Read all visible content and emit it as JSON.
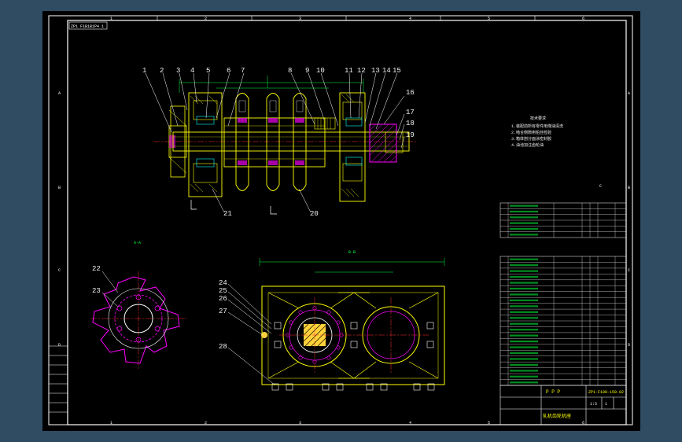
{
  "app": {
    "colors": {
      "desktop": "#2f4c63",
      "sheet": "#000000",
      "border": "#ffffff",
      "yellow": "#ffff00",
      "red": "#ff3030",
      "cyan": "#00ffff",
      "green": "#00ff3c",
      "magenta": "#ff00ff",
      "label": "#f2f2f2"
    }
  },
  "drawing": {
    "title_tag": "ZP1 F1B1B1P4 1",
    "top_ruler": [
      "1",
      "2",
      "3",
      "4",
      "5",
      "6"
    ],
    "bottom_ruler": [
      "1",
      "2",
      "3",
      "4",
      "5",
      "6"
    ],
    "left_ruler": [
      "A",
      "B",
      "C",
      "D"
    ],
    "right_ruler": [
      "A",
      "B",
      "C",
      "D"
    ],
    "callouts_top": [
      "1",
      "2",
      "3",
      "4",
      "5",
      "6",
      "7",
      "8",
      "9",
      "10",
      "11",
      "12",
      "13",
      "14",
      "15"
    ],
    "callouts_right": [
      "16",
      "17",
      "18",
      "19"
    ],
    "callouts_bottom": [
      "21",
      "20"
    ],
    "callouts_section": [
      "22",
      "23"
    ],
    "callouts_housing": [
      "24",
      "25",
      "26",
      "27",
      "28"
    ],
    "section_labels": {
      "aa": "A-A",
      "bb": "B-B",
      "cc": "C"
    },
    "notes": {
      "heading": "技术要求",
      "lines": [
        "1.装配前所有零件用煤油清洗",
        "2.啮合侧隙用铅丝检验",
        "3.箱体剖分面涂密封胶",
        "4.油池加注齿轮油"
      ]
    },
    "title_block": {
      "code": "ZP1-F100-150-02",
      "name": "轧机齿轮机座",
      "company": "P P P",
      "scale": "1:5",
      "sheet": "1"
    }
  }
}
